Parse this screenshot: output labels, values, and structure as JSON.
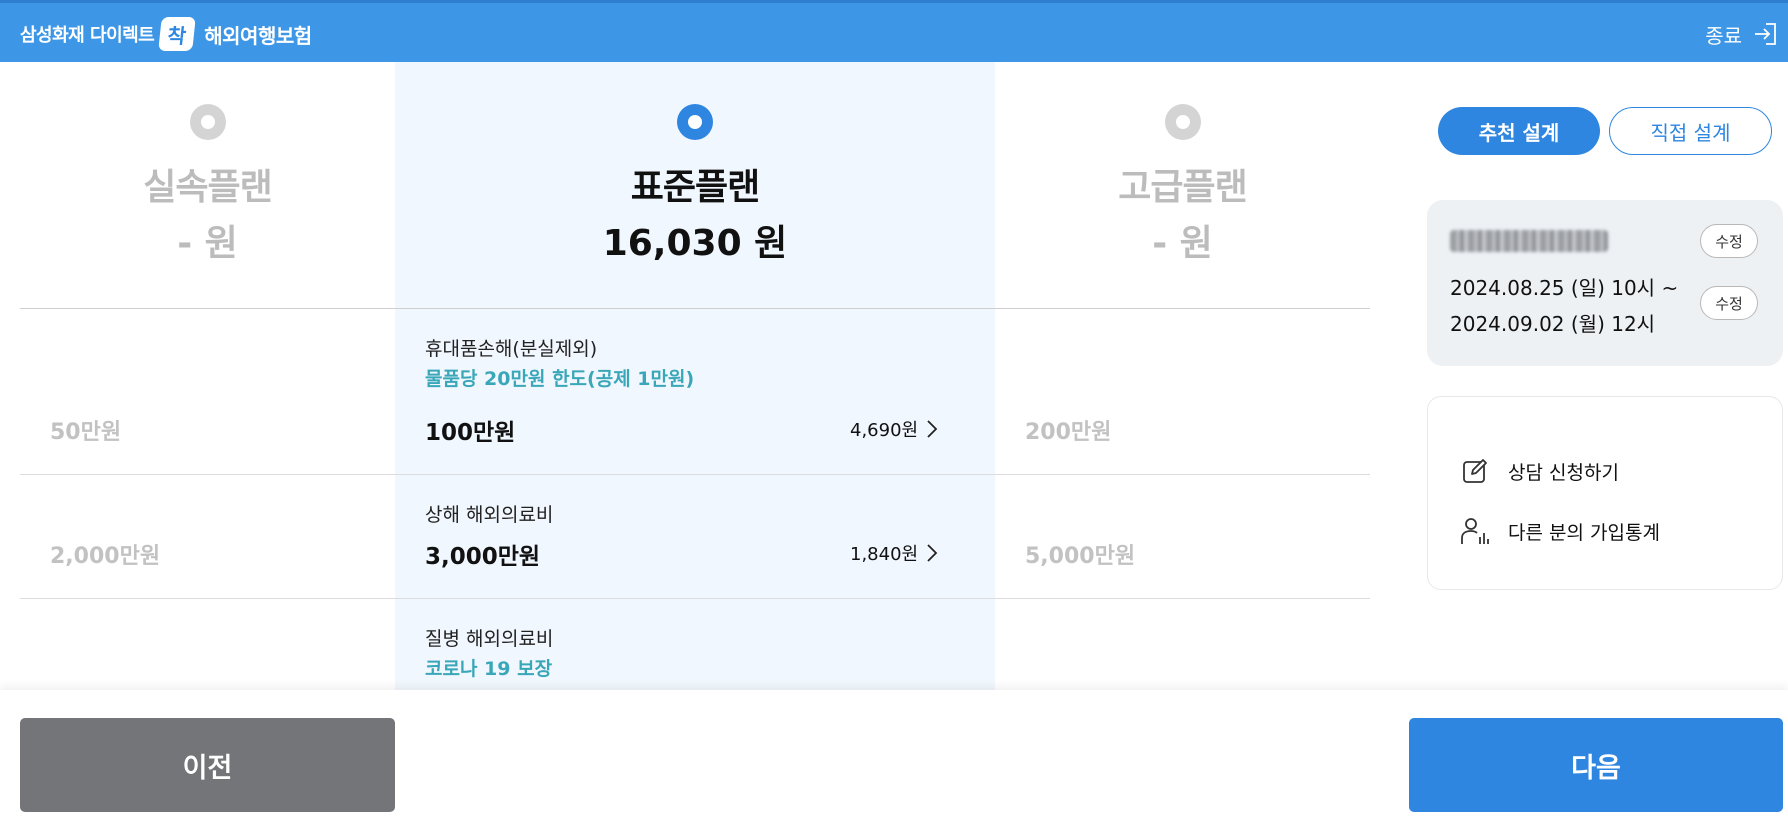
{
  "header": {
    "company": "삼성화재 다이렉트",
    "logo_text": "착",
    "product": "해외여행보험",
    "exit_label": "종료"
  },
  "plans": [
    {
      "name": "실속플랜",
      "price": "- 원",
      "selected": false
    },
    {
      "name": "표준플랜",
      "price": "16,030 원",
      "selected": true
    },
    {
      "name": "고급플랜",
      "price": "- 원",
      "selected": false
    }
  ],
  "coverages": [
    {
      "name": "휴대품손해(분실제외)",
      "note": "물품당 20만원 한도(공제 1만원)",
      "basic": "50만원",
      "standard": "100만원",
      "premium": "200만원",
      "standard_fee": "4,690원"
    },
    {
      "name": "상해 해외의료비",
      "note": "",
      "basic": "2,000만원",
      "standard": "3,000만원",
      "premium": "5,000만원",
      "standard_fee": "1,840원"
    },
    {
      "name": "질병 해외의료비",
      "note": "코로나 19 보장"
    }
  ],
  "buttons": {
    "prev": "이전",
    "next": "다음"
  },
  "side": {
    "tab_recommended": "추천 설계",
    "tab_custom": "직접 설계",
    "edit_label": "수정",
    "period_line1": "2024.08.25 (일) 10시 ~",
    "period_line2": "2024.09.02 (월) 12시",
    "consult_label": "상담 신청하기",
    "stats_label": "다른 분의 가입통계"
  },
  "colors": {
    "header_blue": "#3d97e6",
    "accent_blue": "#2f86e0",
    "teal_note": "#3aa7b9",
    "prev_gray": "#737578",
    "muted_text": "#bcbcbc"
  },
  "icons": [
    "exit-icon",
    "radio-icon",
    "chevron-right-icon",
    "edit-note-icon",
    "people-stats-icon"
  ]
}
